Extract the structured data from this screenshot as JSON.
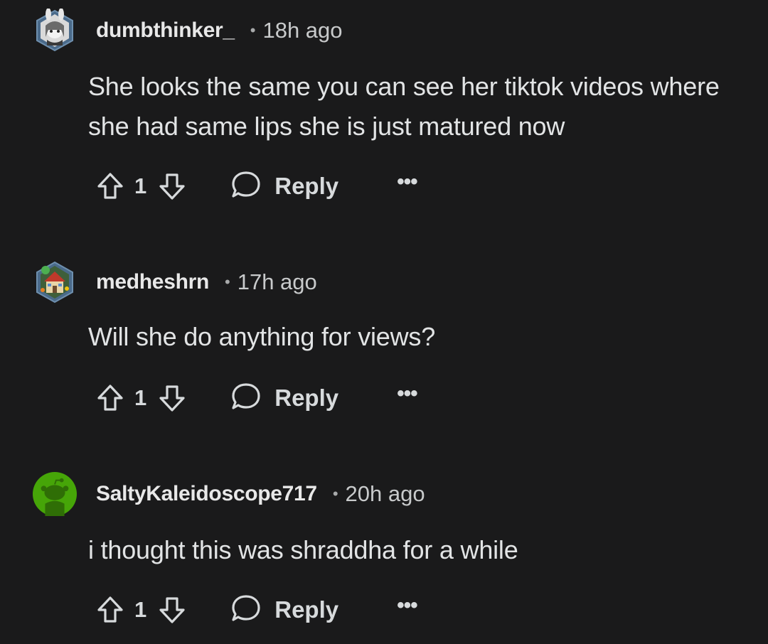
{
  "comments": [
    {
      "username": "dumbthinker_",
      "separator": "•",
      "time": "18h ago",
      "text": "She looks the same you can see her tiktok videos where she had same lips she is just matured now",
      "vote_count": "1",
      "reply_label": "Reply",
      "more_label": "•••",
      "avatar_icon": "anime-avatar-icon"
    },
    {
      "username": "medheshrn",
      "separator": "•",
      "time": "17h ago",
      "text": "Will she do anything for views?",
      "vote_count": "1",
      "reply_label": "Reply",
      "more_label": "•••",
      "avatar_icon": "house-avatar-icon"
    },
    {
      "username": "SaltyKaleidoscope717",
      "separator": "•",
      "time": "20h ago",
      "text": "i thought this was shraddha for a while",
      "vote_count": "1",
      "reply_label": "Reply",
      "more_label": "•••",
      "avatar_icon": "snoo-avatar-icon"
    }
  ],
  "colors": {
    "background": "#1a1a1b",
    "text": "#d7dadc",
    "snoo_avatar_bg": "#46a508"
  }
}
